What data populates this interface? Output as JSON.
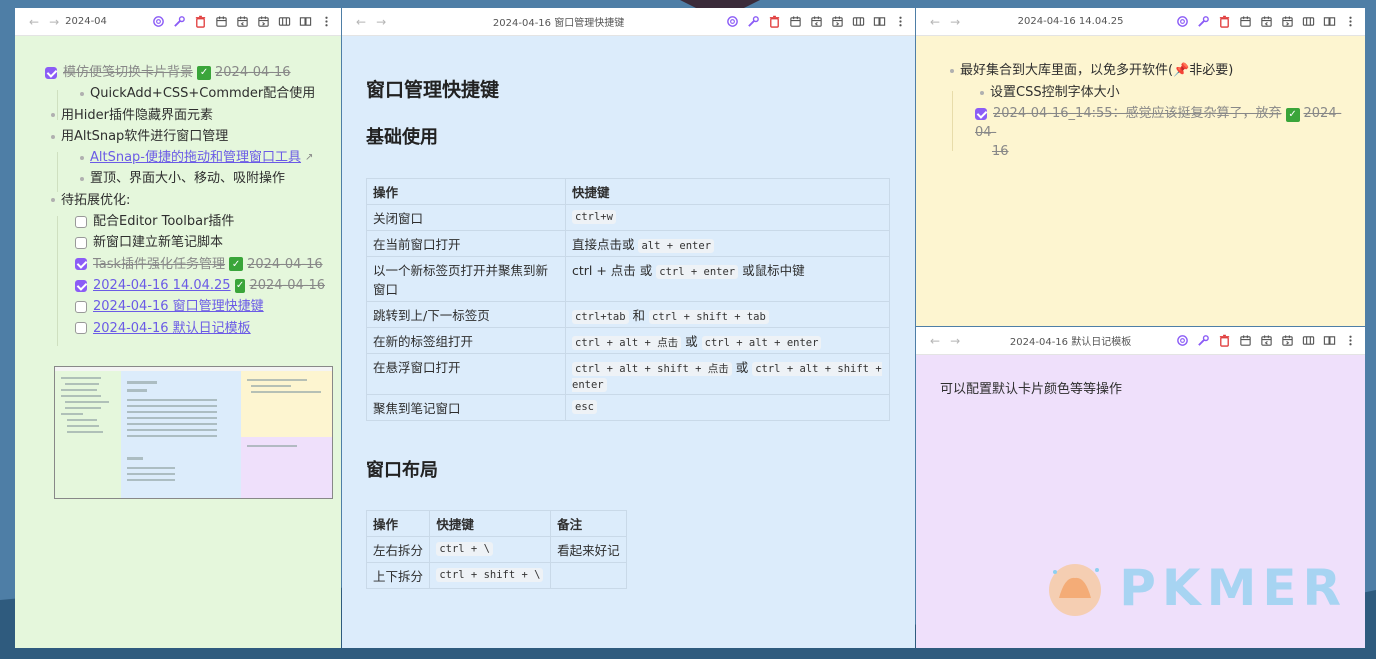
{
  "colors": {
    "left_bg": "#e5f7dc",
    "mid_bg": "#dcecfb",
    "top_right_bg": "#fdf5d0",
    "bottom_right_bg": "#efe0fb",
    "accent": "#8b5cf6",
    "link": "#6b5be6",
    "done_green": "#3aa53a"
  },
  "toolbar_icons": [
    "openai-icon",
    "wrench-icon",
    "trash-icon",
    "calendar-icon",
    "calendar-prev-icon",
    "calendar-next-icon",
    "columns-icon",
    "book-icon",
    "more-icon"
  ],
  "left_pane": {
    "title": "2024-04",
    "items": [
      {
        "type": "task",
        "done": true,
        "text": "模仿便笺切换卡片背景",
        "date": "2024-04-16"
      },
      {
        "type": "bullet",
        "text": "QuickAdd+CSS+Commder配合使用"
      },
      {
        "type": "bullet",
        "text": "用Hider插件隐藏界面元素"
      },
      {
        "type": "bullet",
        "text": "用AltSnap软件进行窗口管理"
      },
      {
        "type": "link",
        "text": "AltSnap-便捷的拖动和管理窗口工具"
      },
      {
        "type": "bullet",
        "text": "置顶、界面大小、移动、吸附操作"
      },
      {
        "type": "bullet",
        "text": "待拓展优化:"
      },
      {
        "type": "task",
        "done": false,
        "text": "配合Editor Toolbar插件"
      },
      {
        "type": "task",
        "done": false,
        "text": "新窗口建立新笔记脚本"
      },
      {
        "type": "task",
        "done": true,
        "text": "Task插件强化任务管理",
        "date": "2024-04-16"
      },
      {
        "type": "task",
        "done": true,
        "text": "2024-04-16 14.04.25",
        "date": "2024-04-16"
      },
      {
        "type": "task",
        "done": false,
        "text": "2024-04-16 窗口管理快捷键"
      },
      {
        "type": "task",
        "done": false,
        "text": "2024-04-16 默认日记模板"
      }
    ]
  },
  "mid_pane": {
    "title": "2024-04-16 窗口管理快捷键",
    "h1": "窗口管理快捷键",
    "h2_basic": "基础使用",
    "table1": {
      "headers": [
        "操作",
        "快捷键"
      ],
      "rows": [
        {
          "op": "关闭窗口",
          "keys": [
            {
              "code": "ctrl+w"
            }
          ]
        },
        {
          "op": "在当前窗口打开",
          "keys": [
            {
              "text": "直接点击或 "
            },
            {
              "code": "alt + enter"
            }
          ]
        },
        {
          "op": "以一个新标签页打开并聚焦到新窗口",
          "keys": [
            {
              "text": "ctrl + 点击 或 "
            },
            {
              "code": "ctrl + enter"
            },
            {
              "text": " 或鼠标中键"
            }
          ]
        },
        {
          "op": "跳转到上/下一标签页",
          "keys": [
            {
              "code": "ctrl+tab"
            },
            {
              "text": " 和 "
            },
            {
              "code": "ctrl + shift + tab"
            }
          ]
        },
        {
          "op": "在新的标签组打开",
          "keys": [
            {
              "code": "ctrl + alt + 点击"
            },
            {
              "text": " 或 "
            },
            {
              "code": "ctrl + alt + enter"
            }
          ]
        },
        {
          "op": "在悬浮窗口打开",
          "keys": [
            {
              "code": "ctrl + alt + shift + 点击"
            },
            {
              "text": " 或 "
            },
            {
              "code": "ctrl + alt + shift + enter"
            }
          ]
        },
        {
          "op": "聚焦到笔记窗口",
          "keys": [
            {
              "code": "esc"
            }
          ]
        }
      ]
    },
    "h2_layout": "窗口布局",
    "table2": {
      "headers": [
        "操作",
        "快捷键",
        "备注"
      ],
      "rows": [
        {
          "op": "左右拆分",
          "key": "ctrl + \\",
          "note": "看起来好记"
        },
        {
          "op": "上下拆分",
          "key": "ctrl + shift + \\",
          "note": ""
        }
      ]
    }
  },
  "top_right_pane": {
    "title": "2024-04-16 14.04.25",
    "line1_pre": "最好集合到大库里面，以免多开软件(",
    "line1_post": "非必要)",
    "line2": "设置CSS控制字体大小",
    "line3a": "2024-04-16_14:55：感觉应该挺复杂算了，放弃",
    "line3_date_a": "2024-04-",
    "line3_date_b": "16"
  },
  "bottom_right_pane": {
    "title": "2024-04-16 默认日记模板",
    "text": "可以配置默认卡片颜色等等操作"
  },
  "watermark": "PKMER"
}
